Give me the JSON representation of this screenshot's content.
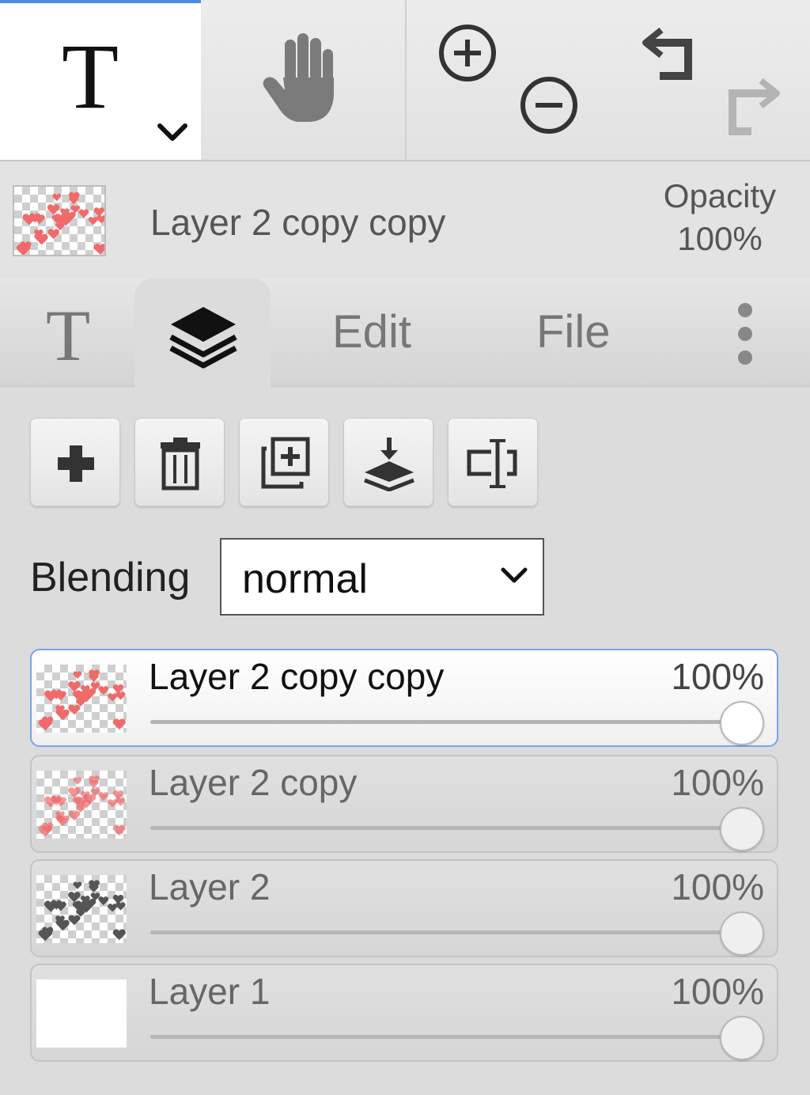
{
  "toolbar": {
    "text_tool_glyph": "T",
    "text_tool_icon": "text-tool-icon",
    "hand_tool_icon": "hand-icon",
    "zoom_in_icon": "zoom-in-icon",
    "zoom_out_icon": "zoom-out-icon",
    "undo_icon": "undo-icon",
    "redo_icon": "redo-icon",
    "active_color": "#4c8be8"
  },
  "current_layer": {
    "name": "Layer 2 copy copy",
    "opacity_label": "Opacity",
    "opacity_value": "100%"
  },
  "tabs": [
    {
      "label": "T",
      "icon": "text-icon"
    },
    {
      "label": "",
      "icon": "layers-icon",
      "active": true
    },
    {
      "label": "Edit"
    },
    {
      "label": "File"
    },
    {
      "label": "",
      "icon": "more-vertical-icon"
    }
  ],
  "layer_actions": [
    {
      "icon": "plus-icon"
    },
    {
      "icon": "trash-icon"
    },
    {
      "icon": "duplicate-icon"
    },
    {
      "icon": "merge-down-icon"
    },
    {
      "icon": "rename-icon"
    }
  ],
  "blending": {
    "label": "Blending",
    "value": "normal"
  },
  "layers": [
    {
      "name": "Layer 2 copy copy",
      "opacity": "100%",
      "opacity_fraction": 1.0,
      "selected": true,
      "thumb": "pink-hearts"
    },
    {
      "name": "Layer 2 copy",
      "opacity": "100%",
      "opacity_fraction": 1.0,
      "selected": false,
      "thumb": "pink-hearts"
    },
    {
      "name": "Layer 2",
      "opacity": "100%",
      "opacity_fraction": 1.0,
      "selected": false,
      "thumb": "dark-hearts"
    },
    {
      "name": "Layer 1",
      "opacity": "100%",
      "opacity_fraction": 1.0,
      "selected": false,
      "thumb": "white"
    }
  ],
  "colors": {
    "heart_pink": "#f06a6a",
    "heart_dark": "#555555",
    "selection_border": "#7aa2f0"
  }
}
